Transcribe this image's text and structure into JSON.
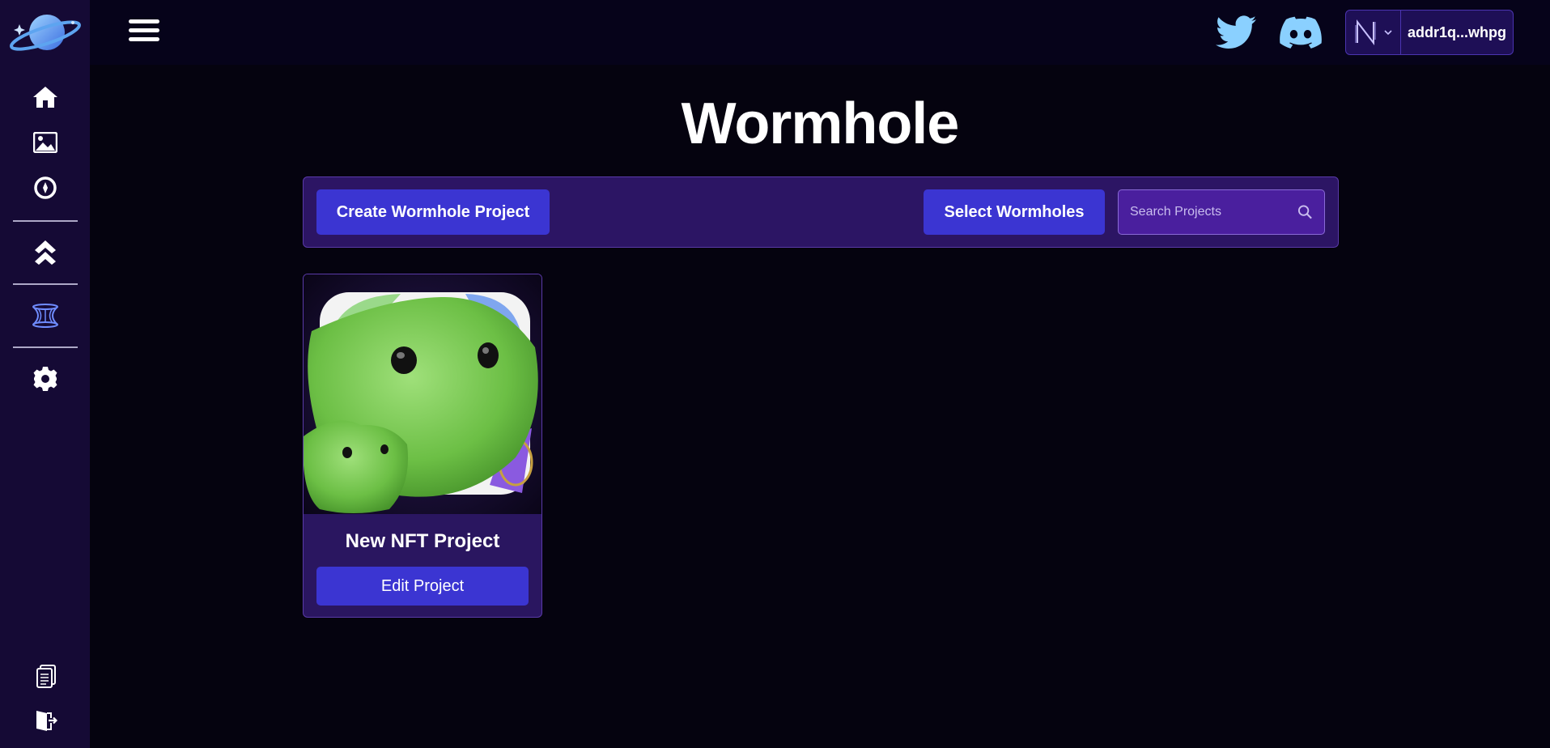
{
  "sidebar": {
    "logo_icon": "planet-logo-icon",
    "items": [
      {
        "name": "home",
        "icon": "home-icon"
      },
      {
        "name": "gallery",
        "icon": "image-icon"
      },
      {
        "name": "explore",
        "icon": "compass-icon"
      },
      {
        "name": "upgrade",
        "icon": "double-chevron-up-icon"
      },
      {
        "name": "wormhole",
        "icon": "wormhole-icon"
      },
      {
        "name": "settings",
        "icon": "gear-icon"
      },
      {
        "name": "docs",
        "icon": "documents-icon"
      },
      {
        "name": "logout",
        "icon": "logout-icon"
      }
    ]
  },
  "topbar": {
    "menu_icon": "hamburger-icon",
    "twitter_icon": "twitter-icon",
    "discord_icon": "discord-icon",
    "wallet": {
      "address": "addr1q...whpg",
      "provider_icon": "wallet-provider-icon"
    }
  },
  "page": {
    "title": "Wormhole"
  },
  "toolbar": {
    "create_label": "Create Wormhole Project",
    "select_label": "Select Wormholes",
    "search_placeholder": "Search Projects"
  },
  "projects": [
    {
      "name": "New NFT Project",
      "action_label": "Edit Project"
    }
  ],
  "colors": {
    "background": "#05030f",
    "sidebar": "#150a35",
    "accent": "#3b35d2",
    "panel": "#2c1564"
  }
}
